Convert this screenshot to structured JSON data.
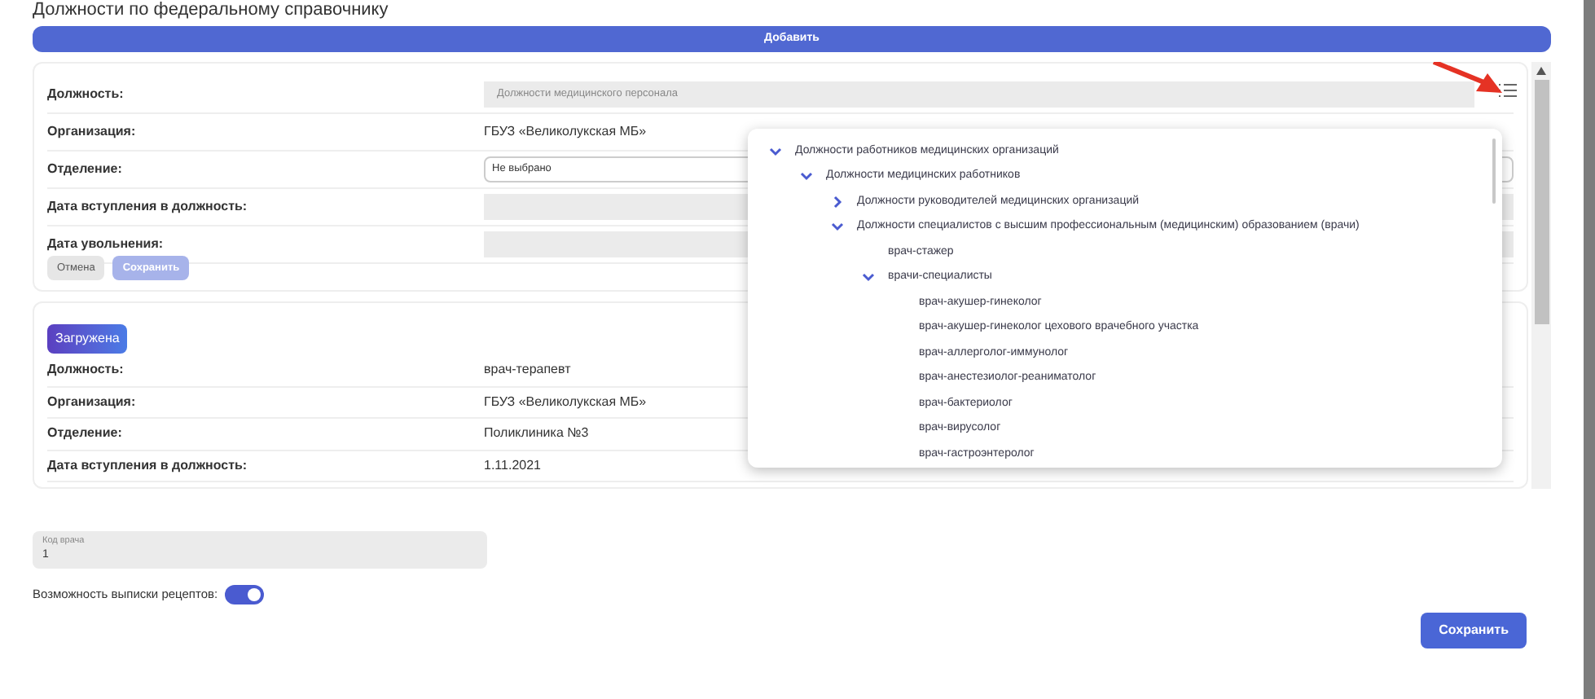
{
  "title": "Должности по федеральному справочнику",
  "add_button": "Добавить",
  "edit_card": {
    "rows": [
      {
        "label": "Должность:",
        "kind": "select",
        "placeholder": "Должности медицинского персонала"
      },
      {
        "label": "Организация:",
        "kind": "text",
        "value": "ГБУЗ «Великолукская МБ»"
      },
      {
        "label": "Отделение:",
        "kind": "input",
        "value": "Не выбрано"
      },
      {
        "label": "Дата вступления в должность:",
        "kind": "empty"
      },
      {
        "label": "Дата увольнения:",
        "kind": "empty"
      }
    ],
    "cancel_button": "Отмена",
    "save_button": {
      "label": "Сохранить",
      "disabled": true
    }
  },
  "loaded_card": {
    "badge": "Загружена",
    "rows": [
      {
        "label": "Должность:",
        "value": "врач-терапевт"
      },
      {
        "label": "Организация:",
        "value": "ГБУЗ «Великолукская МБ»"
      },
      {
        "label": "Отделение:",
        "value": "Поликлиника №3"
      },
      {
        "label": "Дата вступления в должность:",
        "value": "1.11.2021"
      }
    ]
  },
  "tree": [
    {
      "label": "Должности работников медицинских организаций",
      "expanded": true,
      "children": [
        {
          "label": "Должности медицинских работников",
          "expanded": true,
          "children": [
            {
              "label": "Должности руководителей медицинских организаций",
              "expanded": false
            },
            {
              "label": "Должности специалистов с высшим профессиональным (медицинским) образованием (врачи)",
              "expanded": true,
              "children": [
                {
                  "label": "врач-стажер"
                },
                {
                  "label": "врачи-специалисты",
                  "expanded": true,
                  "children": [
                    {
                      "label": "врач-акушер-гинеколог"
                    },
                    {
                      "label": "врач-акушер-гинеколог цехового врачебного участка"
                    },
                    {
                      "label": "врач-аллерголог-иммунолог"
                    },
                    {
                      "label": "врач-анестезиолог-реаниматолог"
                    },
                    {
                      "label": "врач-бактериолог"
                    },
                    {
                      "label": "врач-вирусолог"
                    },
                    {
                      "label": "врач-гастроэнтеролог"
                    }
                  ]
                }
              ]
            }
          ]
        }
      ]
    }
  ],
  "doctor_code": {
    "label": "Код врача",
    "value": "1"
  },
  "prescription_toggle": {
    "label": "Возможность выписки рецептов:",
    "on": true
  },
  "footer_save": "Сохранить"
}
